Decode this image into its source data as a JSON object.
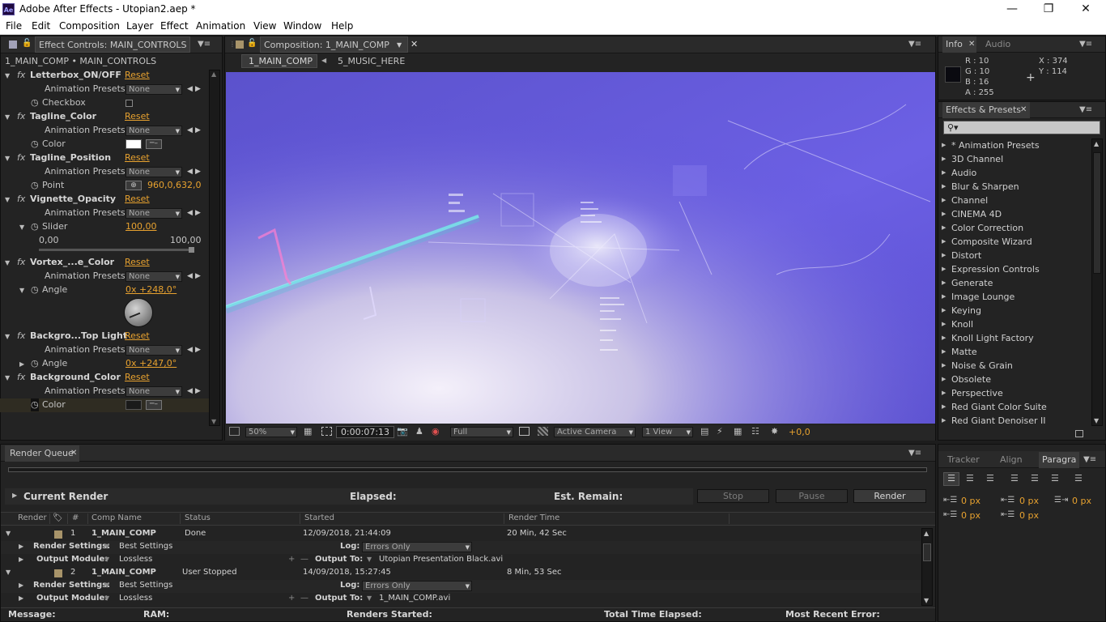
{
  "window": {
    "title": "Adobe After Effects - Utopian2.aep *",
    "app_icon": "Ae",
    "controls": [
      "minimize-icon",
      "restore-icon",
      "close-icon"
    ]
  },
  "menu": [
    "File",
    "Edit",
    "Composition",
    "Layer",
    "Effect",
    "Animation",
    "View",
    "Window",
    "Help"
  ],
  "effect_controls": {
    "tab": "Effect Controls: MAIN_CONTROLS",
    "path": "1_MAIN_COMP • MAIN_CONTROLS",
    "effects": [
      {
        "name": "Letterbox_ON/OFF",
        "reset": "Reset",
        "preset_label": "Animation Presets:",
        "preset_value": "None",
        "prop": "Checkbox"
      },
      {
        "name": "Tagline_Color",
        "reset": "Reset",
        "preset_label": "Animation Presets:",
        "preset_value": "None",
        "prop": "Color"
      },
      {
        "name": "Tagline_Position",
        "reset": "Reset",
        "preset_label": "Animation Presets:",
        "preset_value": "None",
        "prop": "Point",
        "value": "960,0,632,0"
      },
      {
        "name": "Vignette_Opacity",
        "reset": "Reset",
        "preset_label": "Animation Presets:",
        "preset_value": "None",
        "prop": "Slider",
        "value": "100,00",
        "min": "0,00",
        "max": "100,00"
      },
      {
        "name": "Vortex_...e_Color",
        "reset": "Reset",
        "preset_label": "Animation Presets:",
        "preset_value": "None",
        "prop": "Angle",
        "value": "0x +248,0°"
      },
      {
        "name": "Backgro...Top Light",
        "reset": "Reset",
        "preset_label": "Animation Presets:",
        "preset_value": "None",
        "prop": "Angle",
        "value": "0x +247,0°"
      },
      {
        "name": "Background_Color",
        "reset": "Reset",
        "preset_label": "Animation Presets:",
        "preset_value": "None",
        "prop": "Color"
      }
    ],
    "slider_fraction": 1.0,
    "fx_label": "fx"
  },
  "composition": {
    "tab": "Composition: 1_MAIN_COMP",
    "flow_active": "1_MAIN_COMP",
    "flow_next": "5_MUSIC_HERE",
    "zoom": "50%",
    "timecode": "0:00:07:13",
    "resolution": "Full",
    "camera": "Active Camera",
    "views": "1 View",
    "exposure": "+0,0"
  },
  "info": {
    "tab1": "Info",
    "tab2": "Audio",
    "r": "R : 10",
    "g": "G : 10",
    "b": "B : 16",
    "a": "A : 255",
    "x": "X : 374",
    "y": "Y : 114"
  },
  "effects_presets": {
    "tab": "Effects & Presets",
    "items": [
      "* Animation Presets",
      "3D Channel",
      "Audio",
      "Blur & Sharpen",
      "Channel",
      "CINEMA 4D",
      "Color Correction",
      "Composite Wizard",
      "Distort",
      "Expression Controls",
      "Generate",
      "Image Lounge",
      "Keying",
      "Knoll",
      "Knoll Light Factory",
      "Matte",
      "Noise & Grain",
      "Obsolete",
      "Perspective",
      "Red Giant Color Suite",
      "Red Giant Denoiser II"
    ]
  },
  "paragraph": {
    "tabs": [
      "Tracker",
      "Align",
      "Paragra"
    ],
    "indent_values": [
      "0 px",
      "0 px",
      "0 px",
      "0 px",
      "0 px"
    ]
  },
  "render_queue": {
    "tab": "Render Queue",
    "current_render": "Current Render",
    "elapsed": "Elapsed:",
    "est_remain": "Est. Remain:",
    "stop": "Stop",
    "pause": "Pause",
    "render": "Render",
    "columns": [
      "Render",
      "#",
      "Comp Name",
      "Status",
      "Started",
      "Render Time"
    ],
    "items": [
      {
        "num": "1",
        "comp": "1_MAIN_COMP",
        "status": "Done",
        "started": "12/09/2018, 21:44:09",
        "time": "20 Min, 42 Sec",
        "settings": "Best Settings",
        "log": "Errors Only",
        "module": "Lossless",
        "output": "Utopian Presentation Black.avi"
      },
      {
        "num": "2",
        "comp": "1_MAIN_COMP",
        "status": "User Stopped",
        "started": "14/09/2018, 15:27:45",
        "time": "8 Min, 53 Sec",
        "settings": "Best Settings",
        "log": "Errors Only",
        "module": "Lossless",
        "output": "1_MAIN_COMP.avi"
      }
    ],
    "labels": {
      "render_settings": "Render Settings:",
      "output_module": "Output Module:",
      "log": "Log:",
      "output_to": "Output To:"
    }
  },
  "status_bar": {
    "message": "Message:",
    "ram": "RAM:",
    "renders_started": "Renders Started:",
    "total_elapsed": "Total Time Elapsed:",
    "recent_error": "Most Recent Error:"
  }
}
